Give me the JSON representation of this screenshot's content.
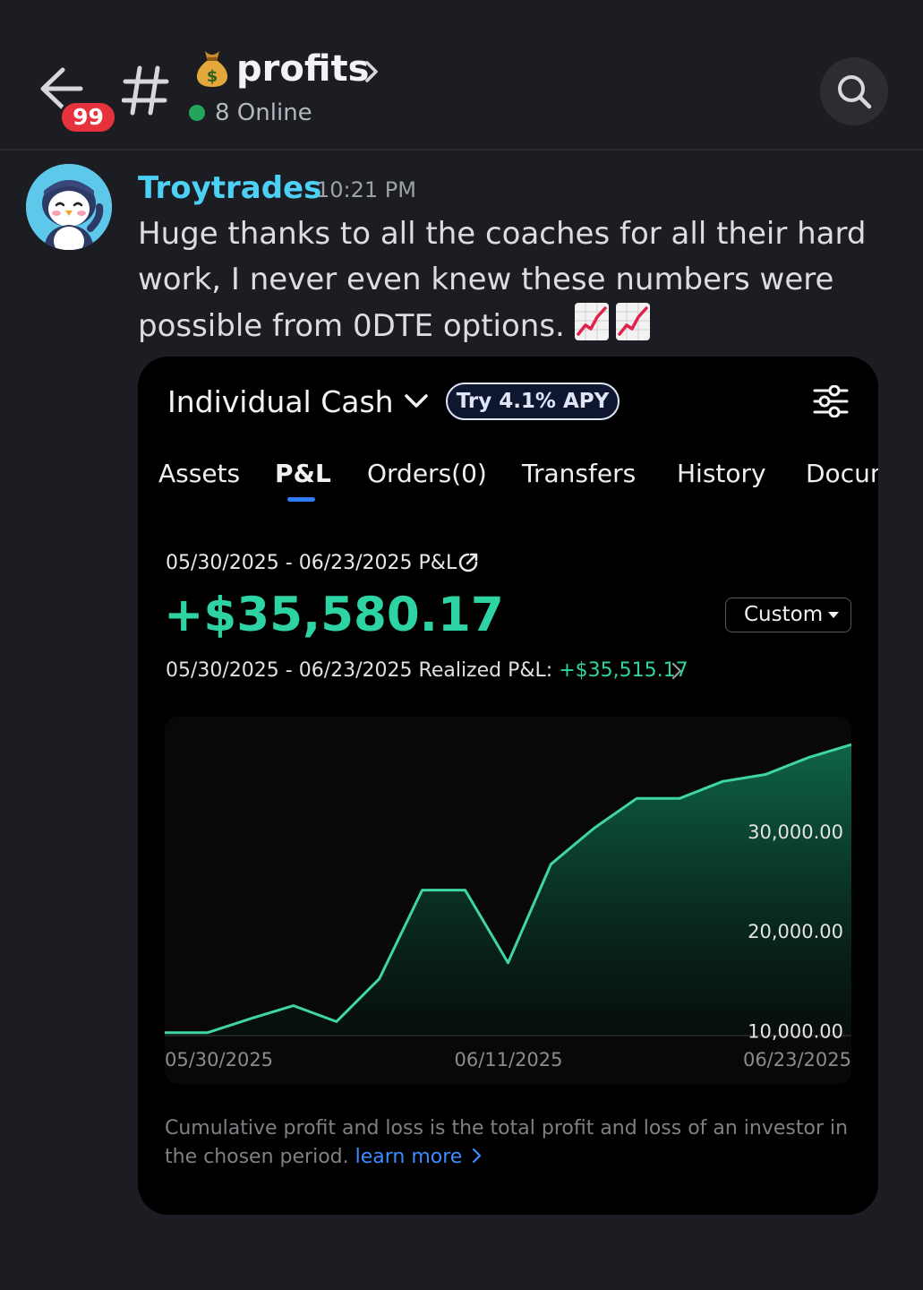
{
  "header": {
    "unread_badge": "99",
    "channel_emoji": "money-bag",
    "channel_name": "profits",
    "online_text": "8 Online"
  },
  "message": {
    "author": "Troytrades",
    "time": "10:21 PM",
    "text": "Huge thanks to all the coaches for all their hard work, I never even knew these numbers were possible from 0DTE options.",
    "emojis": [
      "chart-increasing",
      "chart-increasing"
    ]
  },
  "card": {
    "account_title": "Individual Cash",
    "apy_label": "Try 4.1% APY",
    "tabs": [
      "Assets",
      "P&L",
      "Orders(0)",
      "Transfers",
      "History",
      "Documents"
    ],
    "active_tab": "P&L",
    "range_label": "05/30/2025 - 06/23/2025 P&L",
    "pnl_value": "+$35,580.17",
    "period_select": "Custom",
    "realized_label": "05/30/2025 - 06/23/2025 Realized P&L:",
    "realized_value": "+$35,515.17",
    "footnote": "Cumulative profit and loss is the total profit and loss of an investor in the chosen period.",
    "learn_more": "learn more"
  },
  "colors": {
    "background": "#1c1d22",
    "author": "#4cd0f5",
    "profit_green": "#2ed3a3",
    "tab_underline": "#2f7cf6",
    "link": "#3d8bff",
    "badge_red": "#e5323c",
    "online_green": "#23a55a"
  },
  "chart_data": {
    "type": "area",
    "x": [
      "05/30/2025",
      "06/02/2025",
      "06/03/2025",
      "06/04/2025",
      "06/05/2025",
      "06/06/2025",
      "06/09/2025",
      "06/10/2025",
      "06/11/2025",
      "06/12/2025",
      "06/13/2025",
      "06/16/2025",
      "06/17/2025",
      "06/18/2025",
      "06/19/2025",
      "06/20/2025",
      "06/23/2025"
    ],
    "values": [
      9800,
      9800,
      11200,
      12500,
      10900,
      15200,
      24100,
      24100,
      16800,
      26700,
      30300,
      33300,
      33300,
      35000,
      35700,
      37400,
      38700
    ],
    "x_tick_labels": [
      "05/30/2025",
      "06/11/2025",
      "06/23/2025"
    ],
    "y_tick_labels": [
      "10,000.00",
      "20,000.00",
      "30,000.00"
    ],
    "y_ticks": [
      10000,
      20000,
      30000
    ],
    "ylim": [
      9500,
      41500
    ],
    "y_axis_side": "right",
    "line_color": "#3fd6a2",
    "fill_color": "#0e5a43",
    "grid": false
  }
}
